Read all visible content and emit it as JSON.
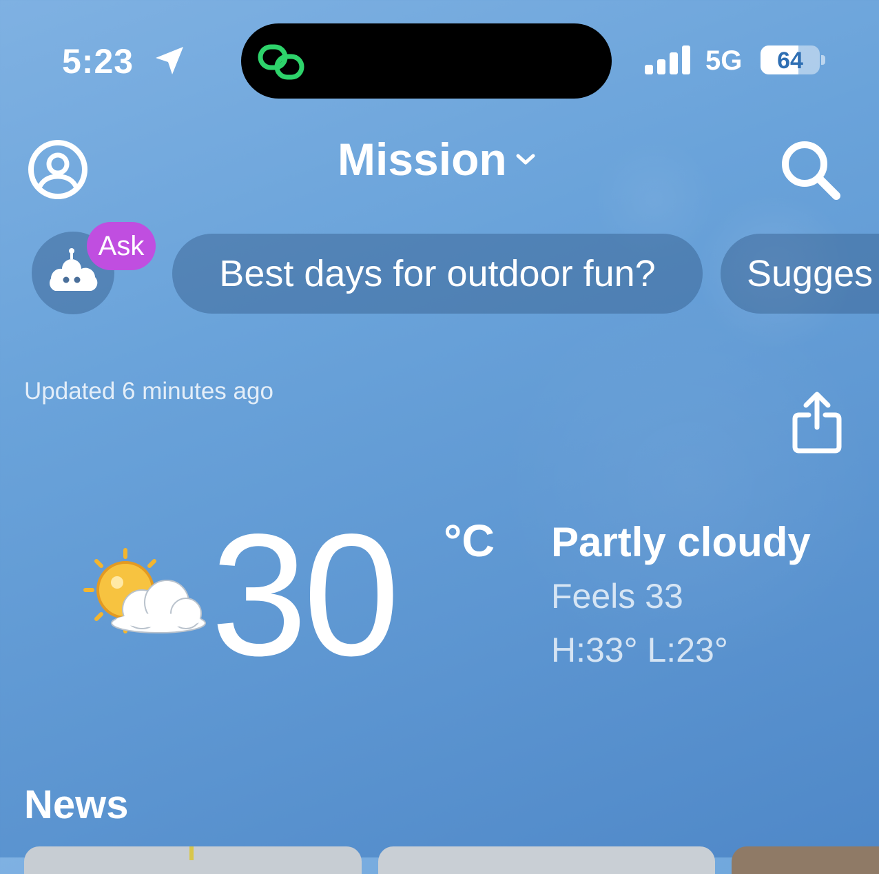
{
  "status_bar": {
    "time": "5:23",
    "network": "5G",
    "battery_level": "64",
    "battery_fraction": 0.64
  },
  "header": {
    "location": "Mission"
  },
  "ask": {
    "badge": "Ask",
    "suggestions": [
      "Best days for outdoor fun?",
      "Sugges"
    ]
  },
  "current": {
    "updated": "Updated 6 minutes ago",
    "temperature": "30",
    "unit": "°C",
    "condition": "Partly cloudy",
    "feels_like": "Feels 33",
    "high_low": "H:33° L:23°",
    "condition_icon": "partly-cloudy-icon"
  },
  "news": {
    "title": "News"
  },
  "colors": {
    "ask_badge": "#c04ee0",
    "island_icon": "#2ed36b",
    "chip_background": "#345c8a"
  }
}
